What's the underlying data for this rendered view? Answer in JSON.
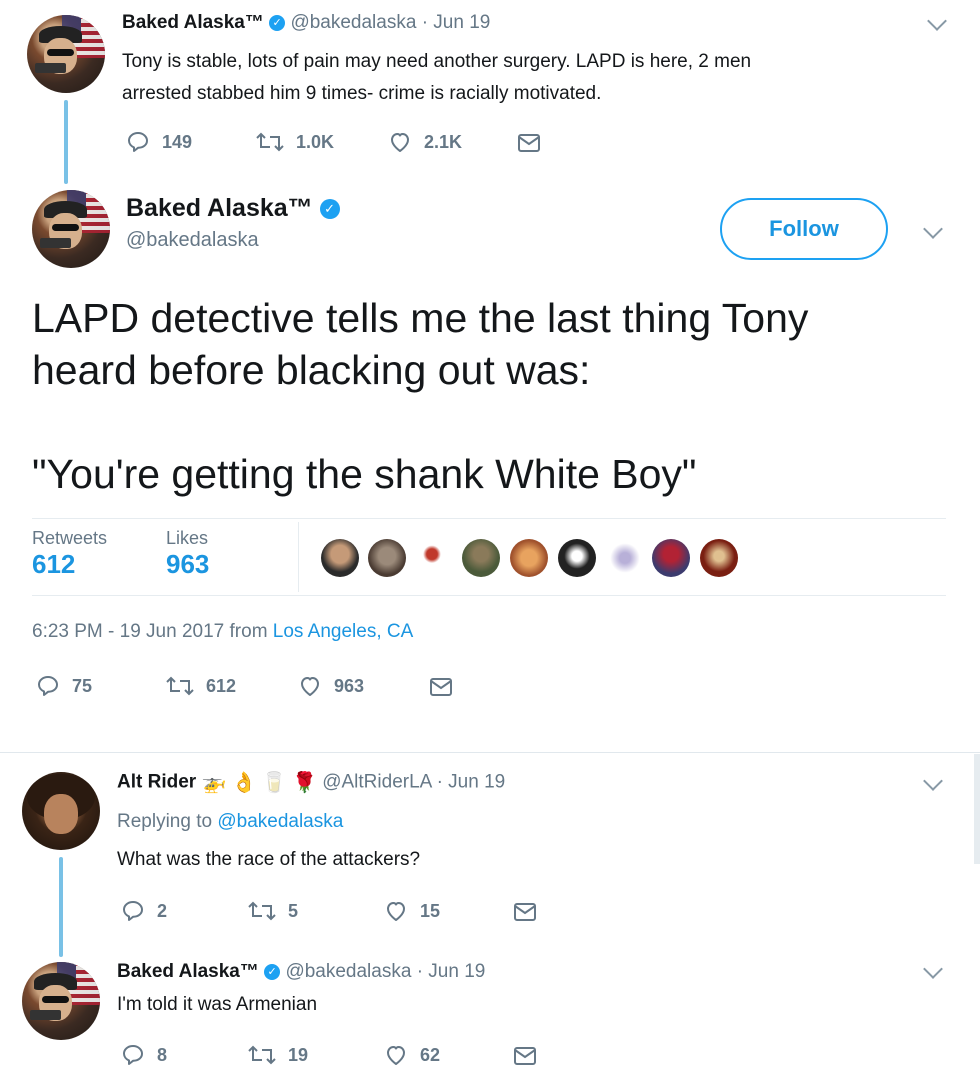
{
  "tweet1": {
    "name": "Baked Alaska™",
    "handle": "@bakedalaska",
    "date": "· Jun 19",
    "text_line1": "Tony is stable, lots of pain may need another surgery. LAPD is here, 2 men",
    "text_line2": "arrested stabbed him 9 times- crime is racially motivated.",
    "replies": "149",
    "retweets": "1.0K",
    "likes": "2.1K"
  },
  "main_tweet": {
    "name": "Baked Alaska™",
    "handle": "@bakedalaska",
    "follow_label": "Follow",
    "text_line1": "LAPD detective tells me the last thing Tony",
    "text_line2": "heard before blacking out was:",
    "text_line3": "\"You're getting the shank White Boy\"",
    "retweets_label": "Retweets",
    "retweets_value": "612",
    "likes_label": "Likes",
    "likes_value": "963",
    "timestamp": "6:23 PM - 19 Jun 2017 from ",
    "location": "Los Angeles, CA",
    "replies": "75",
    "retweets": "612",
    "likes": "963"
  },
  "reply1": {
    "name": "Alt Rider",
    "handle": "@AltRiderLA",
    "date": "· Jun 19",
    "replying_prefix": "Replying to ",
    "replying_to": "@bakedalaska",
    "text": "What was the race of the attackers?",
    "replies": "2",
    "retweets": "5",
    "likes": "15"
  },
  "reply2": {
    "name": "Baked Alaska™",
    "handle": "@bakedalaska",
    "date": "· Jun 19",
    "text": "I'm told it was Armenian",
    "replies": "8",
    "retweets": "19",
    "likes": "62"
  },
  "icons": {
    "reply": "reply-icon",
    "retweet": "retweet-icon",
    "like": "heart-icon",
    "dm": "envelope-icon",
    "verified": "verified-badge-icon",
    "caret": "chevron-down-icon"
  },
  "colors": {
    "link": "#1b95e0",
    "muted": "#657786",
    "verified": "#1da1f2",
    "thread": "#79c1e6"
  }
}
